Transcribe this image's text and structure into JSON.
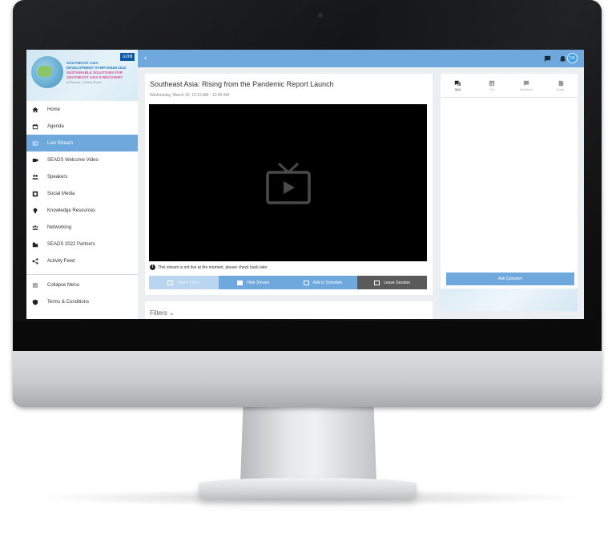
{
  "colors": {
    "accent": "#6fa8dc",
    "accent_light": "#b9d5ef",
    "dark_button": "#5a5a5a",
    "player_bg": "#000000"
  },
  "logo": {
    "badge": "ADB",
    "line1": "SOUTHEAST ASIA",
    "line2": "DEVELOPMENT SYMPOSIUM 2022",
    "line3": "SUSTAINABLE SOLUTIONS FOR",
    "line4": "SOUTHEAST ASIA'S RECOVERY",
    "line5": "in-Person • Online Event"
  },
  "sidebar": {
    "items": [
      {
        "label": "Home",
        "icon": "home-icon"
      },
      {
        "label": "Agenda",
        "icon": "calendar-icon"
      },
      {
        "label": "Live Stream",
        "icon": "tv-icon",
        "active": true
      },
      {
        "label": "SEADS Welcome Video",
        "icon": "video-icon"
      },
      {
        "label": "Speakers",
        "icon": "people-icon"
      },
      {
        "label": "Social Media",
        "icon": "social-icon"
      },
      {
        "label": "Knowledge Resources",
        "icon": "lightbulb-icon"
      },
      {
        "label": "Networking",
        "icon": "network-icon"
      },
      {
        "label": "SEADS 2022 Partners",
        "icon": "building-icon"
      },
      {
        "label": "Activity Feed",
        "icon": "share-icon"
      }
    ],
    "footer": [
      {
        "label": "Collapse Menu",
        "icon": "collapse-icon"
      },
      {
        "label": "Terms & Conditions",
        "icon": "shield-icon"
      }
    ]
  },
  "topbar": {
    "avatar_initials": "FB",
    "back_glyph": "‹"
  },
  "session": {
    "title": "Southeast Asia: Rising from the Pandemic Report Launch",
    "time": "Wednesday, March 16, 12:15 AM - 12:45 AM",
    "notice": "This stream is not live at the moment, please check back later"
  },
  "actions": {
    "watch": "Watch Video",
    "hide": "Hide Stream",
    "schedule": "Add to Schedule",
    "leave": "Leave Session"
  },
  "filters": {
    "label": "Filters ⌄"
  },
  "panel": {
    "tabs": [
      "Q&A",
      "Poll",
      "Feedback",
      "Notes"
    ],
    "ask_button": "Ask Question"
  }
}
